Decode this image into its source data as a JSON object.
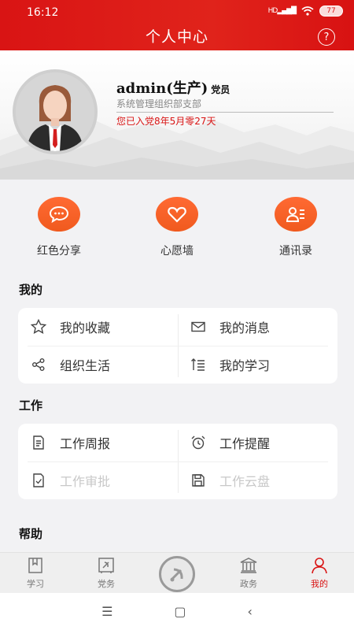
{
  "status": {
    "time": "16:12",
    "signal": "HD",
    "battery": "77"
  },
  "header": {
    "title": "个人中心",
    "help_icon": "question-circle-icon"
  },
  "profile": {
    "name": "admin(生产)",
    "role": "党员",
    "department": "系统管理组织部支部",
    "party_duration": "您已入党8年5月零27天"
  },
  "quick_actions": [
    {
      "label": "红色分享",
      "icon": "chat-bubble-icon"
    },
    {
      "label": "心愿墙",
      "icon": "heart-icon"
    },
    {
      "label": "通讯录",
      "icon": "contacts-icon"
    }
  ],
  "sections": {
    "mine": {
      "title": "我的",
      "items": [
        {
          "label": "我的收藏",
          "icon": "star-icon",
          "enabled": true
        },
        {
          "label": "我的消息",
          "icon": "envelope-icon",
          "enabled": true
        },
        {
          "label": "组织生活",
          "icon": "share-nodes-icon",
          "enabled": true
        },
        {
          "label": "我的学习",
          "icon": "sort-list-icon",
          "enabled": true
        }
      ]
    },
    "work": {
      "title": "工作",
      "items": [
        {
          "label": "工作周报",
          "icon": "document-icon",
          "enabled": true
        },
        {
          "label": "工作提醒",
          "icon": "alarm-clock-icon",
          "enabled": true
        },
        {
          "label": "工作审批",
          "icon": "approval-check-icon",
          "enabled": false
        },
        {
          "label": "工作云盘",
          "icon": "floppy-disk-icon",
          "enabled": false
        }
      ]
    },
    "help": {
      "title": "帮助"
    }
  },
  "tabbar": {
    "items": [
      {
        "label": "学习",
        "icon": "book-icon",
        "active": false
      },
      {
        "label": "党务",
        "icon": "party-flag-icon",
        "active": false
      },
      {
        "label": "",
        "icon": "party-emblem-icon",
        "active": false
      },
      {
        "label": "政务",
        "icon": "government-building-icon",
        "active": false
      },
      {
        "label": "我的",
        "icon": "person-icon",
        "active": true
      }
    ]
  },
  "system_nav": {
    "icons": [
      "menu-icon",
      "home-square-icon",
      "back-chevron-icon"
    ]
  },
  "colors": {
    "primary_red": "#d91414",
    "accent_orange": "#f05a1e",
    "disabled_text": "#c8c8c8"
  }
}
